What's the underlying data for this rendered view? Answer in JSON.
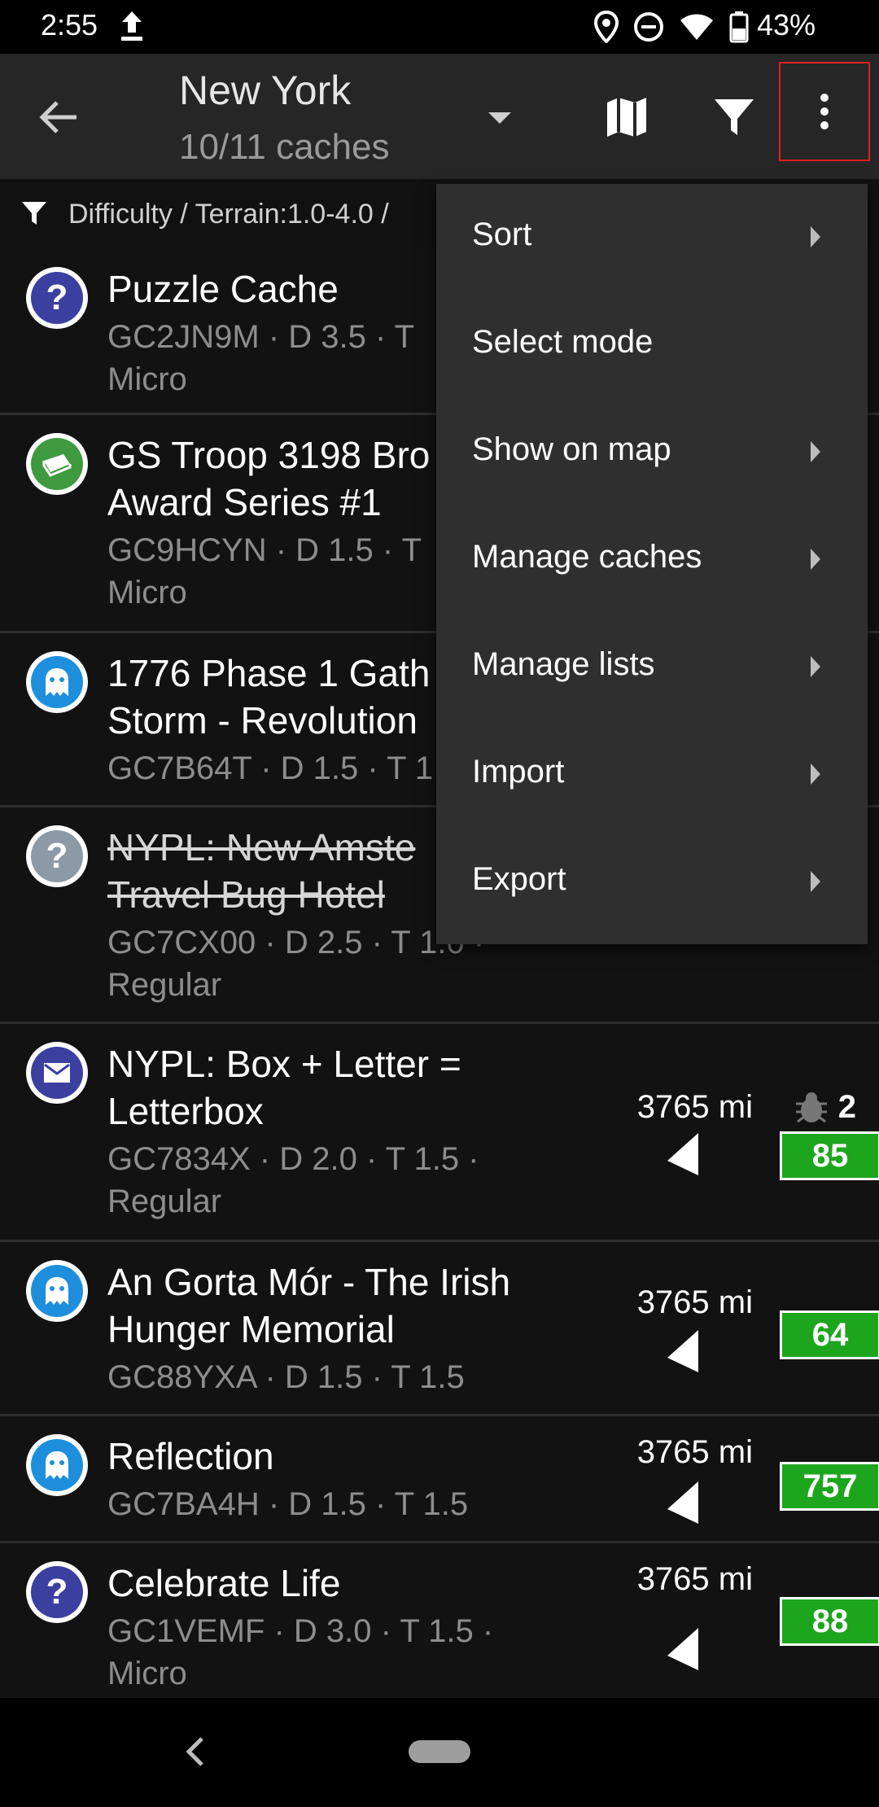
{
  "status_bar": {
    "time": "2:55",
    "battery": "43%",
    "icons": [
      "upload-icon",
      "location-icon",
      "dnd-icon",
      "wifi-icon",
      "battery-icon"
    ]
  },
  "toolbar": {
    "title": "New York",
    "subtitle": "10/11 caches"
  },
  "filter": {
    "text": "Difficulty / Terrain:1.0-4.0 /"
  },
  "menu": {
    "items": [
      {
        "label": "Sort",
        "submenu": true
      },
      {
        "label": "Select mode",
        "submenu": false
      },
      {
        "label": "Show on map",
        "submenu": true
      },
      {
        "label": "Manage caches",
        "submenu": true
      },
      {
        "label": "Manage lists",
        "submenu": true
      },
      {
        "label": "Import",
        "submenu": true
      },
      {
        "label": "Export",
        "submenu": true
      }
    ]
  },
  "caches": [
    {
      "name_lines": [
        "Puzzle Cache"
      ],
      "info_lines": [
        "GC2JN9M · D 3.5 · T",
        "Micro"
      ],
      "type": "mystery",
      "color": "#3a3fa0"
    },
    {
      "name_lines": [
        "GS Troop 3198 Bro",
        "Award Series #1"
      ],
      "info_lines": [
        "GC9HCYN · D 1.5 · T",
        "Micro"
      ],
      "type": "earthcache",
      "color": "#3f9a3f"
    },
    {
      "name_lines": [
        "1776 Phase 1 Gath",
        "Storm - Revolution"
      ],
      "info_lines": [
        "GC7B64T · D 1.5 · T 1"
      ],
      "type": "virtual",
      "color": "#1d8fdc"
    },
    {
      "name_lines": [
        "NYPL: New Amste",
        "Travel Bug Hotel"
      ],
      "info_lines": [
        "GC7CX00 · D 2.5 · T 1.0 ·",
        "Regular"
      ],
      "type": "mystery-disabled",
      "color": "#8b9aa6",
      "archived": true
    },
    {
      "name_lines": [
        "NYPL: Box + Letter =",
        "Letterbox"
      ],
      "info_lines": [
        "GC7834X · D 2.0 · T 1.5 ·",
        "Regular"
      ],
      "type": "letterbox",
      "color": "#3a3fa0",
      "distance": "3765 mi",
      "trackables": "2",
      "favorites": "85"
    },
    {
      "name_lines": [
        "An Gorta Mór - The Irish",
        "Hunger Memorial"
      ],
      "info_lines": [
        "GC88YXA · D 1.5 · T 1.5"
      ],
      "type": "virtual",
      "color": "#1d8fdc",
      "distance": "3765 mi",
      "favorites": "64"
    },
    {
      "name_lines": [
        "Reflection"
      ],
      "info_lines": [
        "GC7BA4H · D 1.5 · T 1.5"
      ],
      "type": "virtual",
      "color": "#1d8fdc",
      "distance": "3765 mi",
      "favorites": "757"
    },
    {
      "name_lines": [
        "Celebrate Life"
      ],
      "info_lines": [
        "GC1VEMF · D 3.0 · T 1.5 ·",
        "Micro"
      ],
      "type": "mystery",
      "color": "#3a3fa0",
      "distance": "3765 mi",
      "favorites": "88"
    }
  ]
}
